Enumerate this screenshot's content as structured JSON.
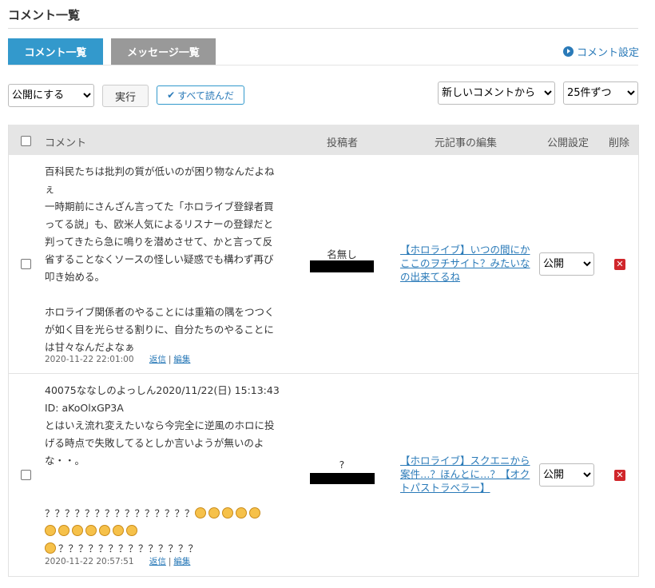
{
  "page_title": "コメント一覧",
  "tabs": [
    {
      "label": "コメント一覧",
      "active": true
    },
    {
      "label": "メッセージ一覧",
      "active": false
    }
  ],
  "settings_link": "コメント設定",
  "toolbar": {
    "visibility_select": "公開にする",
    "run_button": "実行",
    "read_all_button": "すべて読んだ",
    "order_select": "新しいコメントから",
    "per_page_select": "25件ずつ"
  },
  "table": {
    "headers": {
      "comment": "コメント",
      "author": "投稿者",
      "article": "元記事の編集",
      "visibility": "公開設定",
      "delete": "削除"
    },
    "rows": [
      {
        "comment_lines": [
          "百科民たちは批判の質が低いのが困り物なんだよねぇ",
          "一時期前にさんざん言ってた「ホロライブ登録者買ってる説」も、欧米人気によるリスナーの登録だと判ってきたら急に鳴りを潜めさせて、かと言って反省することなくソースの怪しい疑惑でも構わず再び叩き始める。",
          "",
          "ホロライブ関係者のやることには重箱の隅をつつくが如く目を光らせる割りに、自分たちのやることには甘々なんだよなぁ"
        ],
        "timestamp": "2020-11-22 22:01:00",
        "reply_label": "返信",
        "edit_label": "編集",
        "author": "名無し",
        "article_title": "【ホロライブ】いつの間にかここのヲチサイト？みたいなの出来てるね",
        "visibility": "公開"
      },
      {
        "comment_lines": [
          "40075ななしのよっしん2020/11/22(日) 15:13:43 ID: aKoOlxGP3A",
          "とはいえ流れ変えたいなら今完全に逆風のホロに投げる時点で失敗してるとしか言いようが無いのよな・・。",
          "",
          "",
          "？？？？？？？？？？？？？？？",
          "",
          "？？？？？？？？？？？？？？"
        ],
        "timestamp": "2020-11-22 20:57:51",
        "reply_label": "返信",
        "edit_label": "編集",
        "author": "?",
        "article_title": "【ホロライブ】スクエニから案件…？ほんとに…？【オクトパストラベラー】",
        "visibility": "公開"
      }
    ]
  },
  "colors": {
    "accent": "#3399cc",
    "inactive_tab": "#999999",
    "link": "#2a7ab8",
    "delete": "#d0262b",
    "header_bg": "#e5e5e5"
  },
  "icons": {
    "settings": "play-circle-icon",
    "read_all": "check-icon",
    "delete": "delete-x-icon",
    "emoji": "smiley-emoji-icon"
  }
}
